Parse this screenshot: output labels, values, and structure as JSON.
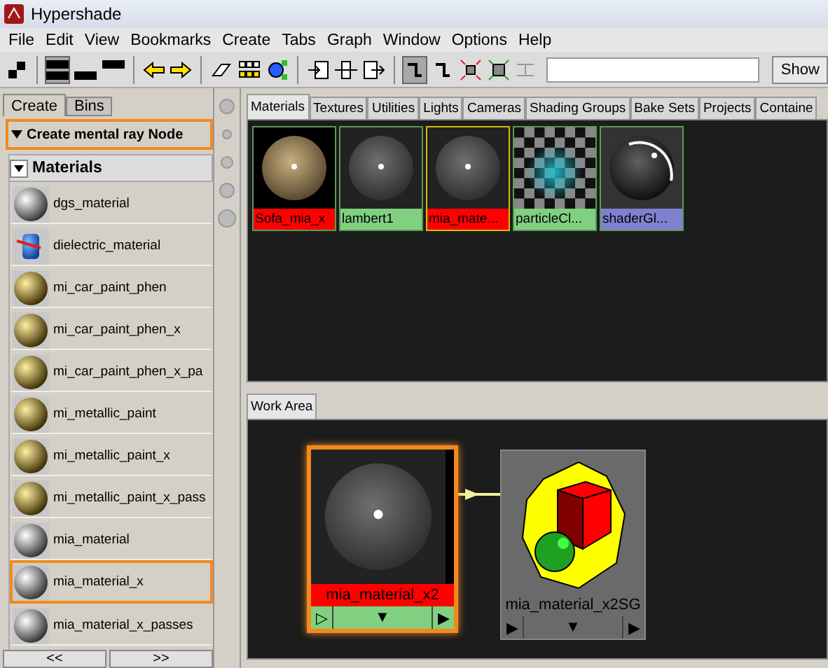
{
  "window": {
    "title": "Hypershade"
  },
  "menu": [
    "File",
    "Edit",
    "View",
    "Bookmarks",
    "Create",
    "Tabs",
    "Graph",
    "Window",
    "Options",
    "Help"
  ],
  "toolbar": {
    "show_button": "Show"
  },
  "left_tabs": [
    {
      "label": "Create",
      "selected": true
    },
    {
      "label": "Bins",
      "selected": false
    }
  ],
  "section": {
    "title": "Create mental ray Node",
    "highlighted": true,
    "expanded": true
  },
  "category": {
    "title": "Materials",
    "expanded": true
  },
  "materials": [
    {
      "name": "dgs_material",
      "kind": "chrome",
      "highlighted": false
    },
    {
      "name": "dielectric_material",
      "kind": "dielectric",
      "highlighted": false
    },
    {
      "name": "mi_car_paint_phen",
      "kind": "gold",
      "highlighted": false
    },
    {
      "name": "mi_car_paint_phen_x",
      "kind": "gold",
      "highlighted": false
    },
    {
      "name": "mi_car_paint_phen_x_pa",
      "kind": "gold",
      "highlighted": false
    },
    {
      "name": "mi_metallic_paint",
      "kind": "gold",
      "highlighted": false
    },
    {
      "name": "mi_metallic_paint_x",
      "kind": "gold",
      "highlighted": false
    },
    {
      "name": "mi_metallic_paint_x_pass",
      "kind": "gold",
      "highlighted": false
    },
    {
      "name": "mia_material",
      "kind": "chrome",
      "highlighted": false
    },
    {
      "name": "mia_material_x",
      "kind": "chrome",
      "highlighted": true
    },
    {
      "name": "mia_material_x_passes",
      "kind": "chrome",
      "highlighted": false
    }
  ],
  "pager": [
    "<<",
    ">>"
  ],
  "top_tabs": [
    {
      "label": "Materials",
      "selected": true
    },
    {
      "label": "Textures",
      "selected": false
    },
    {
      "label": "Utilities",
      "selected": false
    },
    {
      "label": "Lights",
      "selected": false
    },
    {
      "label": "Cameras",
      "selected": false
    },
    {
      "label": "Shading Groups",
      "selected": false
    },
    {
      "label": "Bake Sets",
      "selected": false
    },
    {
      "label": "Projects",
      "selected": false
    },
    {
      "label": "Containe",
      "selected": false
    }
  ],
  "swatches": [
    {
      "label": "Sofa_mia_x",
      "kind": "tan",
      "color": "#ff0000",
      "selected": false
    },
    {
      "label": "lambert1",
      "kind": "grey",
      "color": "#80d080",
      "selected": false
    },
    {
      "label": "mia_mate...",
      "kind": "grey",
      "color": "#ff0000",
      "selected": true
    },
    {
      "label": "particleCl...",
      "kind": "checker",
      "color": "#80d080",
      "selected": false
    },
    {
      "label": "shaderGl...",
      "kind": "glow",
      "color": "#8080d0",
      "selected": false
    }
  ],
  "work_area": {
    "tab": "Work Area",
    "nodes": [
      {
        "label": "mia_material_x2",
        "kind": "material",
        "selected": true,
        "color": "#ff0000",
        "ports": [
          "▷",
          "▼",
          "▶"
        ]
      },
      {
        "label": "mia_material_x2SG",
        "kind": "shading_group",
        "selected": false,
        "color": "#6a6a6a",
        "ports": [
          "▶",
          "▼",
          "▶"
        ]
      }
    ]
  }
}
